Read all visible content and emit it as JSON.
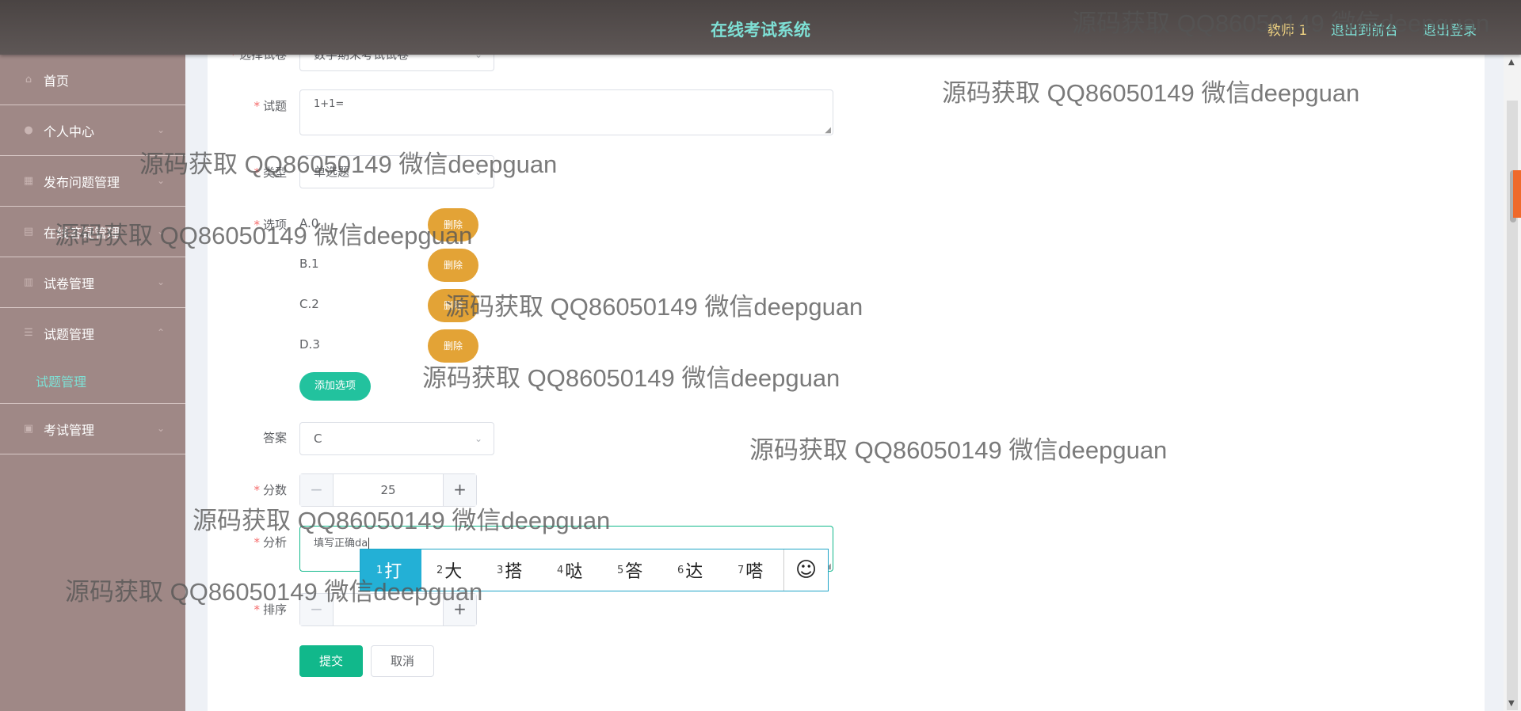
{
  "header": {
    "title": "在线考试系统",
    "user": "教师 1",
    "front_link": "退出到前台",
    "logout": "退出登录"
  },
  "sidebar": {
    "items": [
      {
        "label": "首页",
        "icon": "home-icon"
      },
      {
        "label": "个人中心",
        "icon": "user-icon"
      },
      {
        "label": "发布问题管理",
        "icon": "edit-icon"
      },
      {
        "label": "在线答疑管理",
        "icon": "chat-icon"
      },
      {
        "label": "试卷管理",
        "icon": "document-icon"
      },
      {
        "label": "试题管理",
        "icon": "list-icon"
      },
      {
        "label": "考试管理",
        "icon": "exam-icon"
      }
    ],
    "submenu_label": "试题管理"
  },
  "form": {
    "paper_label": "选择试卷",
    "paper_value": "数学期末考试试卷",
    "question_label": "试题",
    "question_value": "1+1=",
    "type_label": "类型",
    "type_value": "单选题",
    "options_label": "选项",
    "options": [
      "A.0",
      "B.1",
      "C.2",
      "D.3"
    ],
    "delete_label": "删除",
    "add_option_label": "添加选项",
    "answer_label": "答案",
    "answer_value": "C",
    "score_label": "分数",
    "score_value": "25",
    "analysis_label": "分析",
    "analysis_value": "填写正确da",
    "sort_label": "排序",
    "sort_value": "",
    "submit_label": "提交",
    "cancel_label": "取消"
  },
  "ime": {
    "candidates": [
      {
        "num": "1",
        "char": "打"
      },
      {
        "num": "2",
        "char": "大"
      },
      {
        "num": "3",
        "char": "搭"
      },
      {
        "num": "4",
        "char": "哒"
      },
      {
        "num": "5",
        "char": "答"
      },
      {
        "num": "6",
        "char": "达"
      },
      {
        "num": "7",
        "char": "嗒"
      }
    ],
    "emoji": "☺"
  },
  "watermark": "源码获取 QQ86050149 微信deepguan",
  "colors": {
    "header_bg": "#4a4443",
    "header_accent": "#7ee0d5",
    "user_color": "#eed282",
    "sidebar_bg": "#9f8886",
    "delete_button": "#e3a336",
    "add_button": "#22c29e",
    "submit_button": "#11b88b",
    "ime_selected": "#23b0d6"
  }
}
